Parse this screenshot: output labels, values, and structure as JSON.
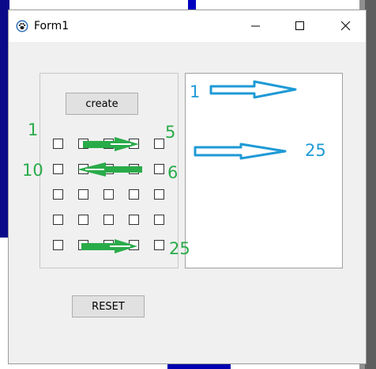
{
  "window": {
    "title": "Form1"
  },
  "icons": {
    "app": "app-paw-icon",
    "minimize": "minimize-icon",
    "maximize": "maximize-icon",
    "close": "close-icon"
  },
  "buttons": {
    "create": "create",
    "reset": "RESET"
  },
  "checkbox_grid": {
    "rows": 5,
    "cols": 5
  },
  "annotations": {
    "left": [
      "1",
      "5",
      "10",
      "6",
      "25"
    ],
    "right": [
      "1",
      "25"
    ]
  },
  "colors": {
    "annotation_green": "#2aab4a",
    "annotation_blue": "#1f9ad6"
  }
}
